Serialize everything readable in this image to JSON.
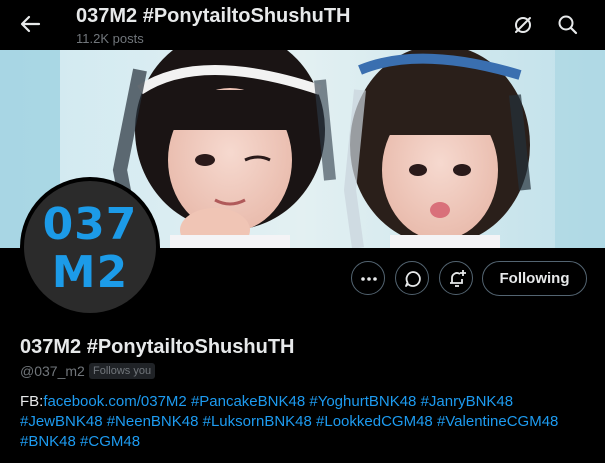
{
  "header": {
    "title": "037M2 #PonytailtoShushuTH",
    "posts_count": "11.2K posts",
    "icons": [
      "back-arrow-icon",
      "grok-icon",
      "search-icon"
    ]
  },
  "profile": {
    "avatar_line1": "037",
    "avatar_line2": "M2",
    "display_name": "037M2 #PonytailtoShushuTH",
    "handle": "@037_m2",
    "follows_you": "Follows you",
    "bio_prefix": "FB:",
    "bio_link": "facebook.com/037M2",
    "hashtags": [
      "#PancakeBNK48",
      "#YoghurtBNK48",
      "#JanryBNK48",
      "#JewBNK48",
      "#NeenBNK48",
      "#LuksornBNK48",
      "#LookkedCGM48",
      "#ValentineCGM48",
      "#BNK48",
      "#CGM48"
    ]
  },
  "actions": {
    "more_icon": "more-icon",
    "message_icon": "message-icon",
    "notify_icon": "bell-plus-icon",
    "following_label": "Following"
  },
  "colors": {
    "background": "#000000",
    "text": "#e7e9ea",
    "muted": "#71767b",
    "link": "#1d9bf0",
    "border": "#536471",
    "avatar_text": "#1c9be8"
  }
}
